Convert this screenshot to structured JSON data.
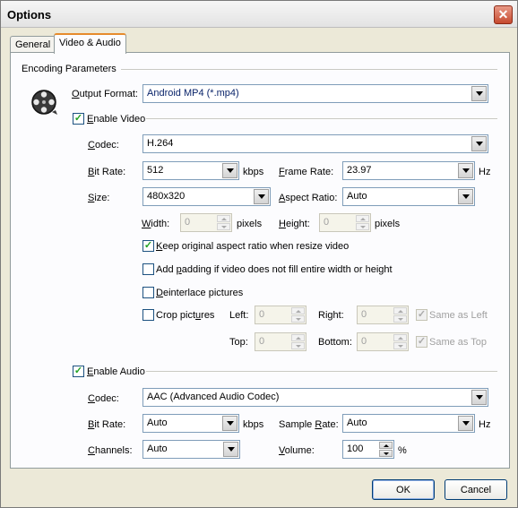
{
  "window": {
    "title": "Options",
    "close_label": "✕"
  },
  "tabs": [
    {
      "label": "General",
      "active": false
    },
    {
      "label": "Video & Audio",
      "active": true
    }
  ],
  "encoding": {
    "group_title": "Encoding Parameters",
    "output_format_label_u": "O",
    "output_format_label_rest": "utput Format:",
    "output_format_value": "Android MP4 (*.mp4)"
  },
  "video": {
    "enable_label_u": "E",
    "enable_label_rest": "nable Video",
    "enabled": true,
    "codec_label_u": "C",
    "codec_label_rest": "odec:",
    "codec_value": "H.264",
    "bitrate_label_u": "B",
    "bitrate_label_rest": "it Rate:",
    "bitrate_value": "512",
    "bitrate_unit": "kbps",
    "framerate_label_u": "F",
    "framerate_label_rest": "rame Rate:",
    "framerate_value": "23.97",
    "framerate_unit": "Hz",
    "size_label_u": "S",
    "size_label_rest": "ize:",
    "size_value": "480x320",
    "aspect_label_u": "A",
    "aspect_label_rest": "spect Ratio:",
    "aspect_value": "Auto",
    "width_label_u": "W",
    "width_label_rest": "idth:",
    "width_value": "0",
    "width_unit": "pixels",
    "height_label_u": "H",
    "height_label_rest": "eight:",
    "height_value": "0",
    "height_unit": "pixels",
    "keep_aspect_label_u": "K",
    "keep_aspect_label_rest": "eep original aspect ratio when resize video",
    "keep_aspect_checked": true,
    "padding_label_pre": "Add ",
    "padding_label_u": "p",
    "padding_label_rest": "adding if video does not fill entire width or height",
    "padding_checked": false,
    "deinterlace_label_u": "D",
    "deinterlace_label_rest": "einterlace pictures",
    "deinterlace_checked": false,
    "crop_label_pre": "Crop pict",
    "crop_label_u": "u",
    "crop_label_rest": "res",
    "crop_checked": false,
    "crop_left_label": "Left:",
    "crop_left_value": "0",
    "crop_right_label": "Right:",
    "crop_right_value": "0",
    "same_as_left_label": "Same as Left",
    "crop_top_label": "Top:",
    "crop_top_value": "0",
    "crop_bottom_label": "Bottom:",
    "crop_bottom_value": "0",
    "same_as_top_label": "Same as Top"
  },
  "audio": {
    "enable_label_u": "E",
    "enable_label_rest": "nable Audio",
    "enabled": true,
    "codec_label_u": "C",
    "codec_label_rest": "odec:",
    "codec_value": "AAC (Advanced Audio Codec)",
    "bitrate_label_u": "B",
    "bitrate_label_rest": "it Rate:",
    "bitrate_value": "Auto",
    "bitrate_unit": "kbps",
    "samplerate_label_pre": "Sample ",
    "samplerate_label_u": "R",
    "samplerate_label_rest": "ate:",
    "samplerate_value": "Auto",
    "samplerate_unit": "Hz",
    "channels_label_u": "C",
    "channels_label_rest": "hannels:",
    "channels_value": "Auto",
    "volume_label_u": "V",
    "volume_label_rest": "olume:",
    "volume_value": "100",
    "volume_unit": "%"
  },
  "buttons": {
    "ok": "OK",
    "cancel": "Cancel"
  }
}
